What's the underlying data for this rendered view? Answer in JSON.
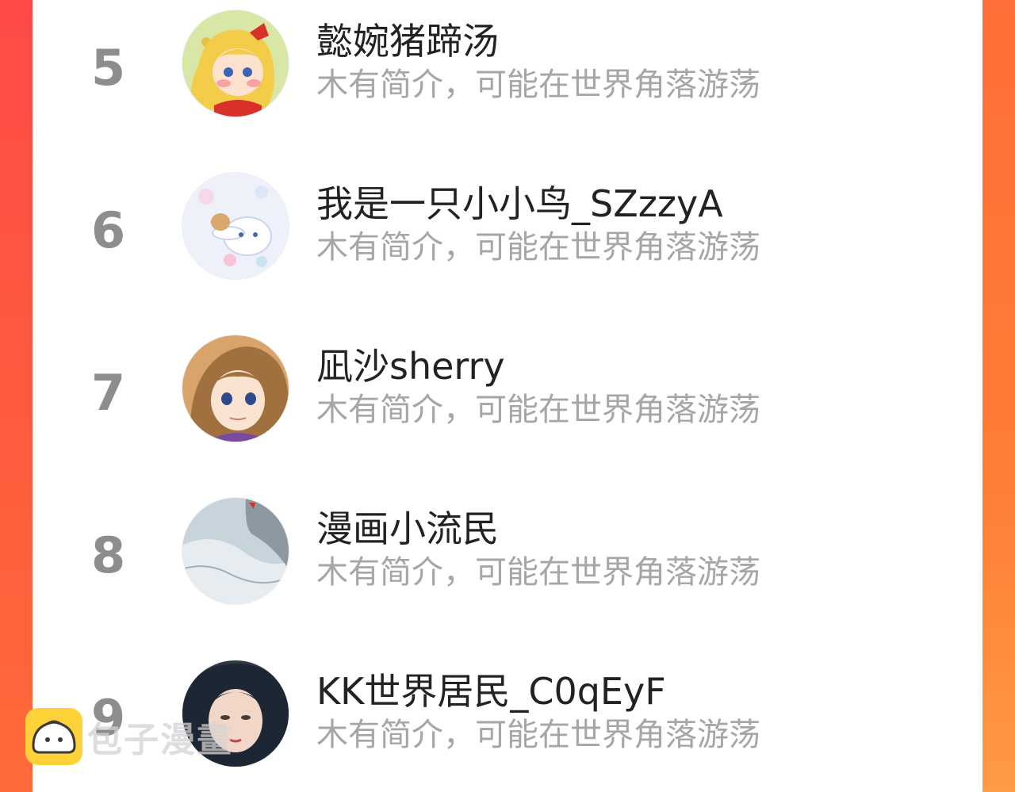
{
  "list": [
    {
      "rank": "5",
      "name": "懿婉猪蹄汤",
      "bio": "木有简介，可能在世界角落游荡",
      "avatar": "sailor-girl-avatar"
    },
    {
      "rank": "6",
      "name": "我是一只小小鸟_SZzzyA",
      "bio": "木有简介，可能在世界角落游荡",
      "avatar": "cinnamoroll-avatar"
    },
    {
      "rank": "7",
      "name": "凪沙sherry",
      "bio": "木有简介，可能在世界角落游荡",
      "avatar": "anime-girl-avatar"
    },
    {
      "rank": "8",
      "name": "漫画小流民",
      "bio": "木有简介，可能在世界角落游荡",
      "avatar": "airplane-wing-avatar"
    },
    {
      "rank": "9",
      "name": "KK世界居民_C0qEyF",
      "bio": "木有简介，可能在世界角落游荡",
      "avatar": "portrait-photo-avatar"
    }
  ],
  "watermark": {
    "text": "包子漫畫",
    "icon": "bun-logo-icon"
  },
  "colors": {
    "left_bar": "#ff4a48",
    "right_bar": "#ff7d35",
    "rank": "#8d8d8d",
    "name": "#222222",
    "bio": "#a6a6a6"
  }
}
